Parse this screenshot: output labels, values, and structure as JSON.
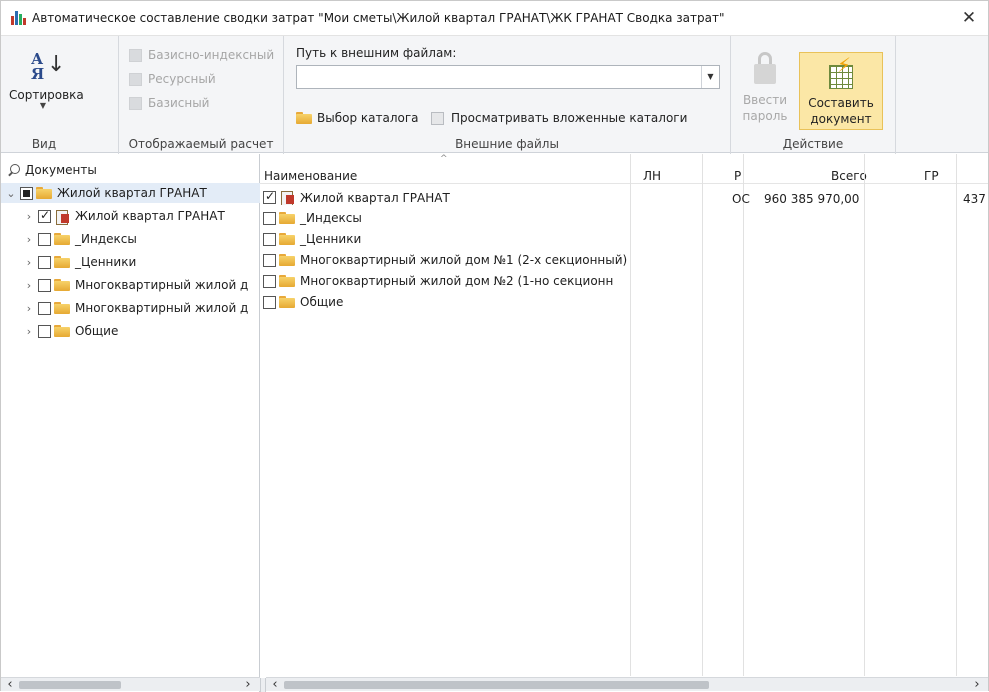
{
  "window": {
    "title": "Автоматическое составление сводки затрат \"Мои сметы\\Жилой квартал ГРАНАТ\\ЖК ГРАНАТ Сводка затрат\"",
    "close_glyph": "✕"
  },
  "ribbon": {
    "view_group": {
      "sort_label": "Сортировка",
      "sort_glyph_top": "А",
      "sort_glyph_bottom": "Я",
      "caption": "Вид"
    },
    "calc_group": {
      "options": [
        "Базисно-индексный",
        "Ресурсный",
        "Базисный"
      ],
      "caption": "Отображаемый расчет"
    },
    "files_group": {
      "path_label": "Путь к внешним файлам:",
      "path_value": "",
      "select_folder_label": "Выбор каталога",
      "nested_label": "Просматривать вложенные каталоги",
      "caption": "Внешние файлы"
    },
    "action_group": {
      "password_label_1": "Ввести",
      "password_label_2": "пароль",
      "compose_label_1": "Составить",
      "compose_label_2": "документ",
      "caption": "Действие"
    }
  },
  "tree": {
    "header": "Документы",
    "root": "Жилой квартал ГРАНАТ",
    "children": [
      "Жилой квартал ГРАНАТ",
      "_Индексы",
      "_Ценники",
      "Многоквартирный жилой д",
      "Многоквартирный жилой д",
      "Общие"
    ]
  },
  "grid": {
    "columns": [
      "Наименование",
      "ЛН",
      "Р",
      "Всего",
      "ГР"
    ],
    "rows": [
      {
        "name": "Жилой квартал ГРАНАТ",
        "ln": "",
        "r": "ОС",
        "total": "960 385 970,00",
        "gr": "437"
      },
      {
        "name": "_Индексы",
        "ln": "",
        "r": "",
        "total": "",
        "gr": ""
      },
      {
        "name": "_Ценники",
        "ln": "",
        "r": "",
        "total": "",
        "gr": ""
      },
      {
        "name": "Многоквартирный жилой дом №1 (2-х секционный)",
        "ln": "",
        "r": "",
        "total": "",
        "gr": ""
      },
      {
        "name": "Многоквартирный жилой дом №2 (1-но секционн",
        "ln": "",
        "r": "",
        "total": "",
        "gr": ""
      },
      {
        "name": "Общие",
        "ln": "",
        "r": "",
        "total": "",
        "gr": ""
      }
    ]
  },
  "icons": {
    "app": "app-chart-icon",
    "search": "search-icon",
    "folder": "folder-icon",
    "document": "estimate-document-icon",
    "lock": "lock-icon",
    "compose": "compose-document-icon"
  },
  "colors": {
    "highlight_button_bg": "#fbe7a6",
    "selection_bg": "#e3ecf7",
    "folder_yellow": "#f7d26a"
  }
}
